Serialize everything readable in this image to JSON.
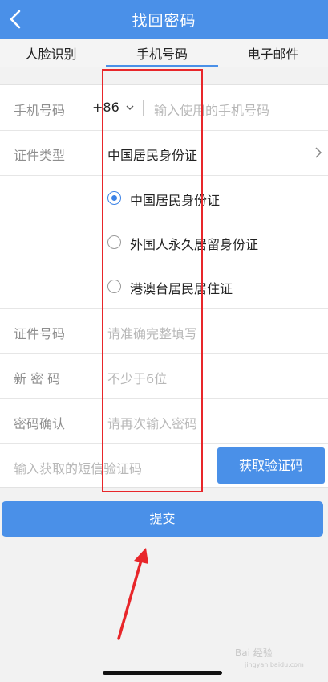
{
  "header": {
    "title": "找回密码",
    "back_icon": "chevron-left-icon"
  },
  "tabs": [
    {
      "label": "人脸识别",
      "active": false
    },
    {
      "label": "手机号码",
      "active": true
    },
    {
      "label": "电子邮件",
      "active": false
    }
  ],
  "form": {
    "phone": {
      "label": "手机号码",
      "country_code": "+86",
      "placeholder": "输入使用的手机号码"
    },
    "id_type": {
      "label": "证件类型",
      "value": "中国居民身份证",
      "options": [
        "中国居民身份证",
        "外国人永久居留身份证",
        "港澳台居民居住证"
      ],
      "selected_index": 0
    },
    "id_number": {
      "label": "证件号码",
      "placeholder": "请准确完整填写"
    },
    "new_password": {
      "label": "新 密 码",
      "placeholder": "不少于6位"
    },
    "confirm_password": {
      "label": "密码确认",
      "placeholder": "请再次输入密码"
    },
    "sms": {
      "placeholder": "输入获取的短信验证码",
      "button_label": "获取验证码"
    }
  },
  "submit_label": "提交",
  "watermark": {
    "text": "Bai 经验",
    "subtext": "jingyan.baidu.com"
  },
  "colors": {
    "primary": "#4a90e8",
    "annotation": "#e8262a"
  }
}
